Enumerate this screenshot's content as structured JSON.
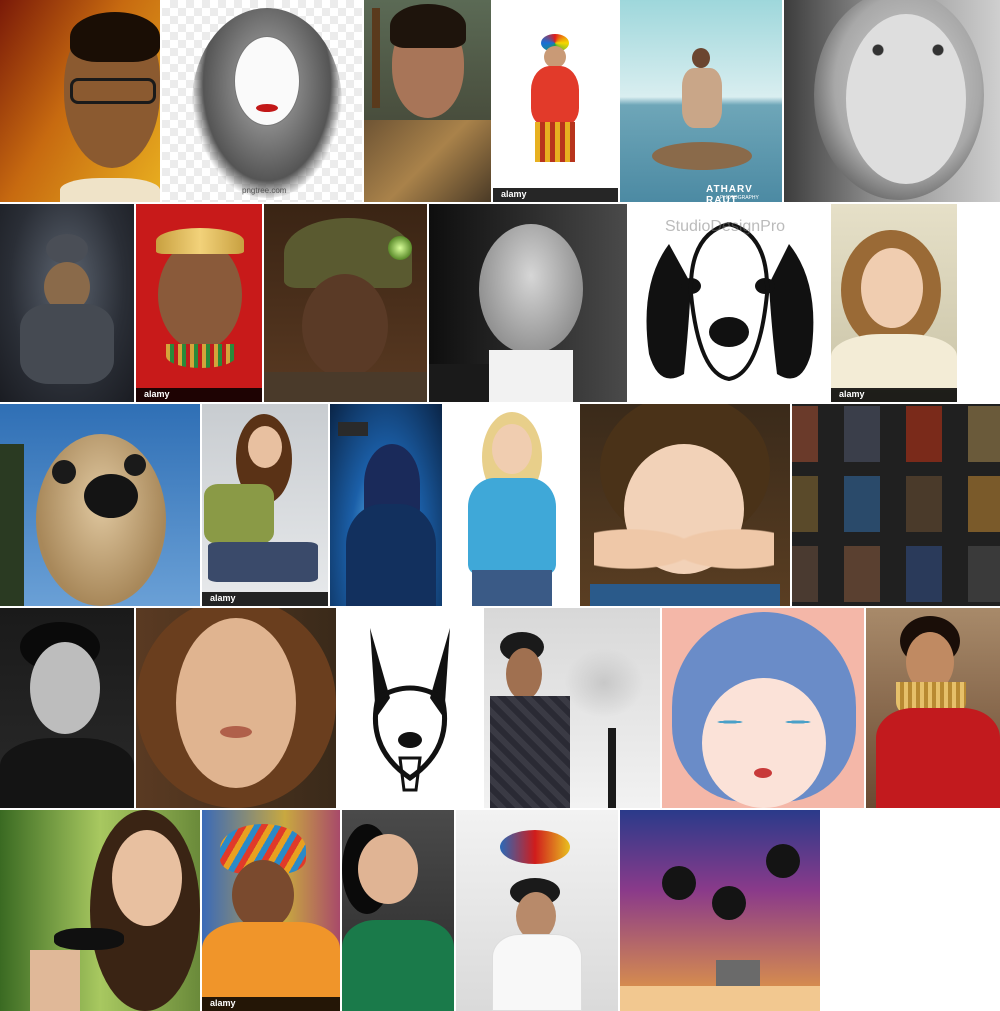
{
  "watermarks": {
    "alamy": "alamy",
    "pngtree": "pngtree.com",
    "atharv_title": "Atharv Raut",
    "atharv_sub": "PHOTOGRAPHY",
    "studio": "StudioDesignPro"
  },
  "colors": {
    "page_background": "#ffffff",
    "grid_gap": "#ffffff"
  }
}
